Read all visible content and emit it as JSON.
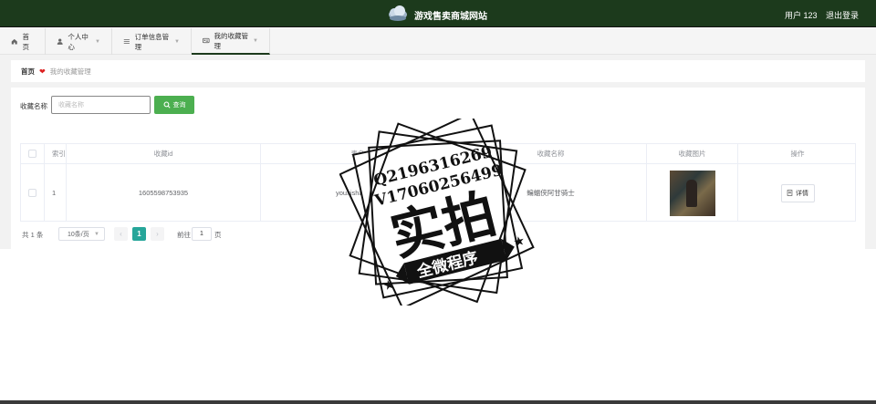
{
  "header": {
    "title": "游戏售卖商城网站",
    "user": "用户 123",
    "logout": "退出登录"
  },
  "nav": {
    "items": [
      {
        "label": "首页",
        "icon": "home-icon"
      },
      {
        "label": "个人中心",
        "icon": "user-icon"
      },
      {
        "label": "订单信息管理",
        "icon": "list-icon"
      },
      {
        "label": "我的收藏管理",
        "icon": "id-card-icon"
      }
    ]
  },
  "breadcrumb": {
    "home": "首页",
    "current": "我的收藏管理"
  },
  "search": {
    "label": "收藏名称",
    "placeholder": "收藏名称",
    "button": "查询"
  },
  "table": {
    "headers": [
      "索引",
      "收藏id",
      "表名",
      "收藏名称",
      "收藏图片",
      "操作"
    ],
    "rows": [
      {
        "index": "1",
        "id": "1605598753935",
        "table_name": "youxishangpin",
        "name": "蝙蝠侠阿甘骑士",
        "action": "详情"
      }
    ]
  },
  "pagination": {
    "total": "共 1 条",
    "page_size": "10条/页",
    "current": "1",
    "goto_label": "前往",
    "goto_value": "1",
    "page_unit": "页"
  },
  "watermark": {
    "line1": "Q2196316269",
    "line2": "V17060256499",
    "main": "实拍",
    "sub": "全微程序"
  },
  "colors": {
    "header_bg": "#1c3a1c",
    "search_button": "#4caf50",
    "active_page": "#26a69a"
  }
}
